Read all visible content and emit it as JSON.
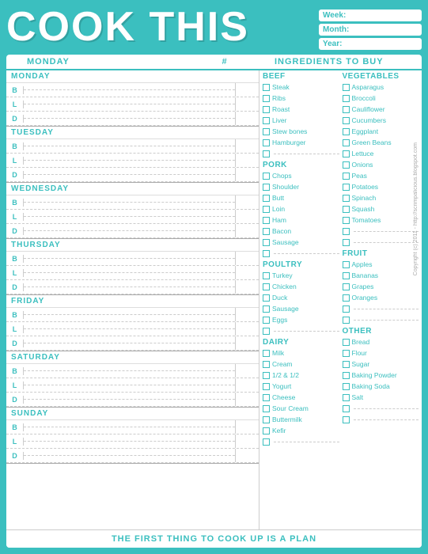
{
  "header": {
    "title": "COOK THIS",
    "fields": [
      {
        "label": "Week:",
        "value": ""
      },
      {
        "label": "Month:",
        "value": ""
      },
      {
        "label": "Year:",
        "value": ""
      }
    ]
  },
  "columns": {
    "day_header": "MONDAY",
    "hash_header": "#",
    "ingredients_header": "INGREDIENTS TO BUY"
  },
  "days": [
    {
      "name": "MONDAY",
      "meals": [
        "B",
        "L",
        "D"
      ]
    },
    {
      "name": "TUESDAY",
      "meals": [
        "B",
        "L",
        "D"
      ]
    },
    {
      "name": "WEDNESDAY",
      "meals": [
        "B",
        "L",
        "D"
      ]
    },
    {
      "name": "THURSDAY",
      "meals": [
        "B",
        "L",
        "D"
      ]
    },
    {
      "name": "FRIDAY",
      "meals": [
        "B",
        "L",
        "D"
      ]
    },
    {
      "name": "SATURDAY",
      "meals": [
        "B",
        "L",
        "D"
      ]
    },
    {
      "name": "SUNDAY",
      "meals": [
        "B",
        "L",
        "D"
      ]
    }
  ],
  "ingredients": {
    "beef": {
      "title": "BEEF",
      "items": [
        "Steak",
        "Ribs",
        "Roast",
        "Liver",
        "Stew bones",
        "Hamburger",
        ""
      ]
    },
    "pork": {
      "title": "PORK",
      "items": [
        "Chops",
        "Shoulder",
        "Butt",
        "Loin",
        "Ham",
        "Bacon",
        "Sausage",
        ""
      ]
    },
    "poultry": {
      "title": "POULTRY",
      "items": [
        "Turkey",
        "Chicken",
        "Duck",
        "Sausage",
        "Eggs",
        ""
      ]
    },
    "dairy": {
      "title": "DAIRY",
      "items": [
        "Milk",
        "Cream",
        "1/2 & 1/2",
        "Yogurt",
        "Cheese",
        "Sour Cream",
        "Buttermilk",
        "Kefir",
        ""
      ]
    },
    "vegetables": {
      "title": "VEGETABLES",
      "items": [
        "Asparagus",
        "Broccoli",
        "Cauliflower",
        "Cucumbers",
        "Eggplant",
        "Green Beans",
        "Lettuce",
        "Onions",
        "Peas",
        "Potatoes",
        "Spinach",
        "Squash",
        "Tomatoes",
        "",
        ""
      ]
    },
    "fruit": {
      "title": "FRUIT",
      "items": [
        "Apples",
        "Bananas",
        "Grapes",
        "Oranges",
        "",
        ""
      ]
    },
    "other": {
      "title": "OTHER",
      "items": [
        "Bread",
        "Flour",
        "Sugar",
        "Baking Powder",
        "Baking Soda",
        "Salt",
        "",
        ""
      ]
    }
  },
  "footer": {
    "text": "THE FIRST THING TO COOK UP IS A PLAN"
  },
  "copyright": "Copyright (c) 2011 - http://scrimpalicious.blogspot.com"
}
